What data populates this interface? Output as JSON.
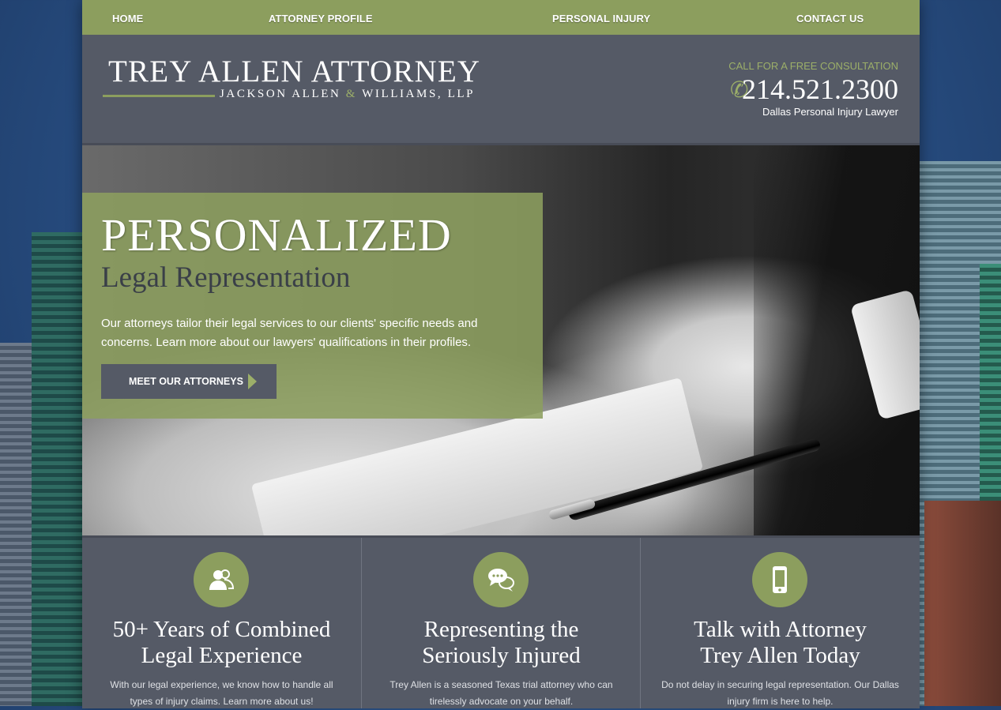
{
  "nav": {
    "items": [
      "HOME",
      "ATTORNEY PROFILE",
      "PERSONAL INJURY",
      "CONTACT US"
    ]
  },
  "header": {
    "logo_title": "TREY ALLEN ATTORNEY",
    "logo_sub_a": "JACKSON ALLEN",
    "logo_sub_amp": "&",
    "logo_sub_b": "WILLIAMS, LLP",
    "cta": "CALL FOR A FREE CONSULTATION",
    "phone": "214.521.2300",
    "phone_icon": "phone-icon",
    "tagline": "Dallas Personal Injury Lawyer"
  },
  "hero": {
    "title": "PERSONALIZED",
    "subtitle": "Legal Representation",
    "text": "Our attorneys tailor their legal services to our clients' specific needs and concerns. Learn more about our lawyers' qualifications in their profiles.",
    "button": "MEET OUR ATTORNEYS"
  },
  "features": [
    {
      "icon": "people-icon",
      "title_1": "50+ Years of Combined",
      "title_2": "Legal Experience",
      "text": "With our legal experience, we know how to handle all types of injury claims. Learn more about us!"
    },
    {
      "icon": "chat-bubbles-icon",
      "title_1": "Representing the",
      "title_2": "Seriously Injured",
      "text": "Trey Allen is a seasoned Texas trial attorney who can tirelessly advocate on your behalf."
    },
    {
      "icon": "mobile-phone-icon",
      "title_1": "Talk with Attorney",
      "title_2": "Trey Allen Today",
      "text": "Do not delay in securing legal representation. Our Dallas injury firm is here to help."
    }
  ],
  "colors": {
    "accent_green": "#8c9e5e",
    "panel_gray": "#555a66"
  }
}
